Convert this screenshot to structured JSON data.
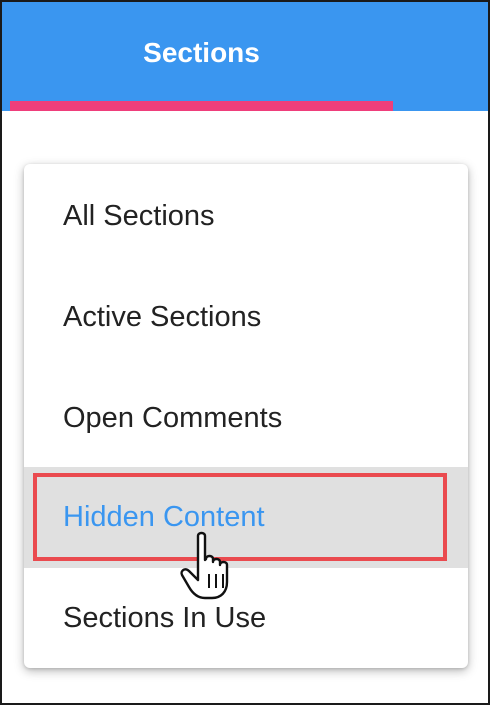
{
  "header": {
    "tab_label": "Sections",
    "background_color": "#3a96f0",
    "indicator_color": "#ef3e7b"
  },
  "menu": {
    "items": [
      {
        "label": "All Sections",
        "active": false
      },
      {
        "label": "Active Sections",
        "active": false
      },
      {
        "label": "Open Comments",
        "active": false
      },
      {
        "label": "Hidden Content",
        "active": true
      },
      {
        "label": "Sections In Use",
        "active": false
      }
    ]
  },
  "annotation": {
    "highlight_color": "#ea4a4f",
    "cursor": "hand-pointer-icon"
  }
}
